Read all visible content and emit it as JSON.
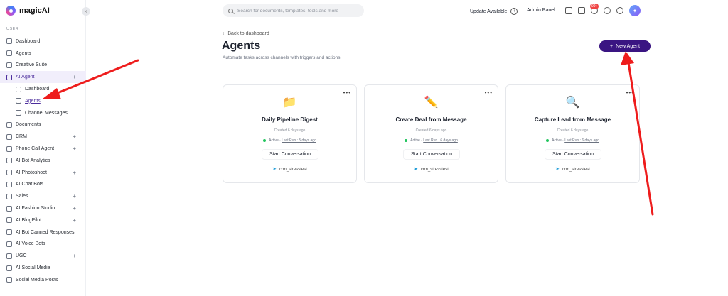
{
  "app": {
    "name": "magicAI"
  },
  "sidebar": {
    "section_label": "USER",
    "items": [
      {
        "label": "Dashboard",
        "plus": ""
      },
      {
        "label": "Agents",
        "plus": ""
      },
      {
        "label": "Creative Suite",
        "plus": ""
      },
      {
        "label": "AI Agent",
        "plus": "+"
      },
      {
        "label": "Dashboard",
        "plus": ""
      },
      {
        "label": "Agents",
        "plus": ""
      },
      {
        "label": "Channel Messages",
        "plus": ""
      },
      {
        "label": "Documents",
        "plus": ""
      },
      {
        "label": "CRM",
        "plus": "+"
      },
      {
        "label": "Phone Call Agent",
        "plus": "+"
      },
      {
        "label": "AI Bot Analytics",
        "plus": ""
      },
      {
        "label": "AI Photoshoot",
        "plus": "+"
      },
      {
        "label": "AI Chat Bots",
        "plus": ""
      },
      {
        "label": "Sales",
        "plus": "+"
      },
      {
        "label": "AI Fashion Studio",
        "plus": "+"
      },
      {
        "label": "AI BlogPilot",
        "plus": "+"
      },
      {
        "label": "AI Bot Canned Responses",
        "plus": ""
      },
      {
        "label": "AI Voice Bots",
        "plus": ""
      },
      {
        "label": "UGC",
        "plus": "+"
      },
      {
        "label": "AI Social Media",
        "plus": ""
      },
      {
        "label": "Social Media Posts",
        "plus": ""
      }
    ]
  },
  "header": {
    "search_placeholder": "Search for documents, templates, tools and more",
    "update_label": "Update Available",
    "admin_label": "Admin Panel",
    "notification_count": "99+"
  },
  "main": {
    "back_label": "Back to dashboard",
    "title": "Agents",
    "subtitle": "Automate tasks across channels with triggers and actions.",
    "new_agent_label": "New Agent",
    "cards": [
      {
        "emoji": "📁",
        "title": "Daily Pipeline Digest",
        "created": "Created 6 days ago",
        "status": "Active",
        "last_run": "Last Run : 5 days ago",
        "start_label": "Start Conversation",
        "channel": "crm_stresstest"
      },
      {
        "emoji": "✏️",
        "title": "Create Deal from Message",
        "created": "Created 6 days ago",
        "status": "Active",
        "last_run": "Last Run : 6 days ago",
        "start_label": "Start Conversation",
        "channel": "crm_stresstest"
      },
      {
        "emoji": "🔍",
        "title": "Capture Lead from Message",
        "created": "Created 6 days ago",
        "status": "Active",
        "last_run": "Last Run : 6 days ago",
        "start_label": "Start Conversation",
        "channel": "crm_stresstest"
      }
    ]
  },
  "colors": {
    "accent": "#3a1582",
    "active_bg": "#f1eefb",
    "annotation": "#ee1c1c"
  }
}
